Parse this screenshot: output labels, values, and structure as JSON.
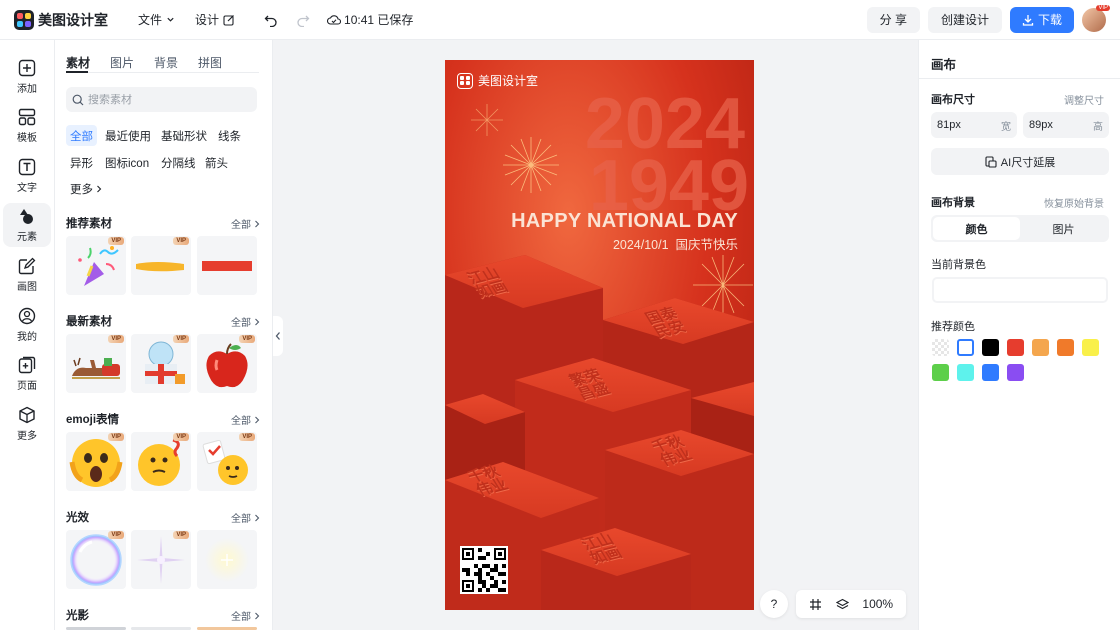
{
  "app": {
    "name": "美图设计室"
  },
  "menu": {
    "file": "文件",
    "design": "设计",
    "saved_status": "10:41 已保存"
  },
  "actions": {
    "share": "分 享",
    "create": "创建设计",
    "download": "下载"
  },
  "user": {
    "vip_badge": "VIP"
  },
  "rail": [
    {
      "label": "添加",
      "icon": "plus-square-icon"
    },
    {
      "label": "模板",
      "icon": "template-icon"
    },
    {
      "label": "文字",
      "icon": "text-icon"
    },
    {
      "label": "元素",
      "icon": "elements-icon"
    },
    {
      "label": "画图",
      "icon": "draw-icon"
    },
    {
      "label": "我的",
      "icon": "user-icon"
    },
    {
      "label": "页面",
      "icon": "add-page-icon"
    },
    {
      "label": "更多",
      "icon": "cube-icon"
    }
  ],
  "panel": {
    "tabs": [
      "素材",
      "图片",
      "背景",
      "拼图"
    ],
    "search_placeholder": "搜索素材",
    "chips": [
      "全部",
      "最近使用",
      "基础形状",
      "线条",
      "异形",
      "图标icon",
      "分隔线",
      "箭头",
      "更多"
    ],
    "all_label": "全部",
    "vip_label": "VIP",
    "sections": [
      {
        "title": "推荐素材"
      },
      {
        "title": "最新素材"
      },
      {
        "title": "emoji表情"
      },
      {
        "title": "光效"
      },
      {
        "title": "光影"
      }
    ]
  },
  "poster": {
    "brand": "美图设计室",
    "year1": "2024",
    "year2": "1949",
    "headline": "HAPPY NATIONAL DAY",
    "subline": "2024/10/1  国庆节快乐",
    "block_text": [
      "江山",
      "如画",
      "国泰",
      "民安",
      "繁荣",
      "昌盛",
      "千秋",
      "伟业"
    ]
  },
  "zoom": {
    "help": "?",
    "level": "100%"
  },
  "right": {
    "title": "画布",
    "size_label": "画布尺寸",
    "adjust_size": "调整尺寸",
    "width_value": "81px",
    "width_unit": "宽",
    "height_value": "89px",
    "height_unit": "高",
    "ai_extend": "AI尺寸延展",
    "bg_label": "画布背景",
    "restore_bg": "恢复原始背景",
    "seg_color": "颜色",
    "seg_image": "图片",
    "current_bg": "当前背景色",
    "recommended": "推荐颜色",
    "colors": [
      "transparent",
      "#ffffff",
      "#000000",
      "#e63d2e",
      "#f4a64e",
      "#f07a2a",
      "#f9f04a",
      "#5dcf4a",
      "#5ef2ec",
      "#2f7bff",
      "#8a4df2"
    ]
  }
}
